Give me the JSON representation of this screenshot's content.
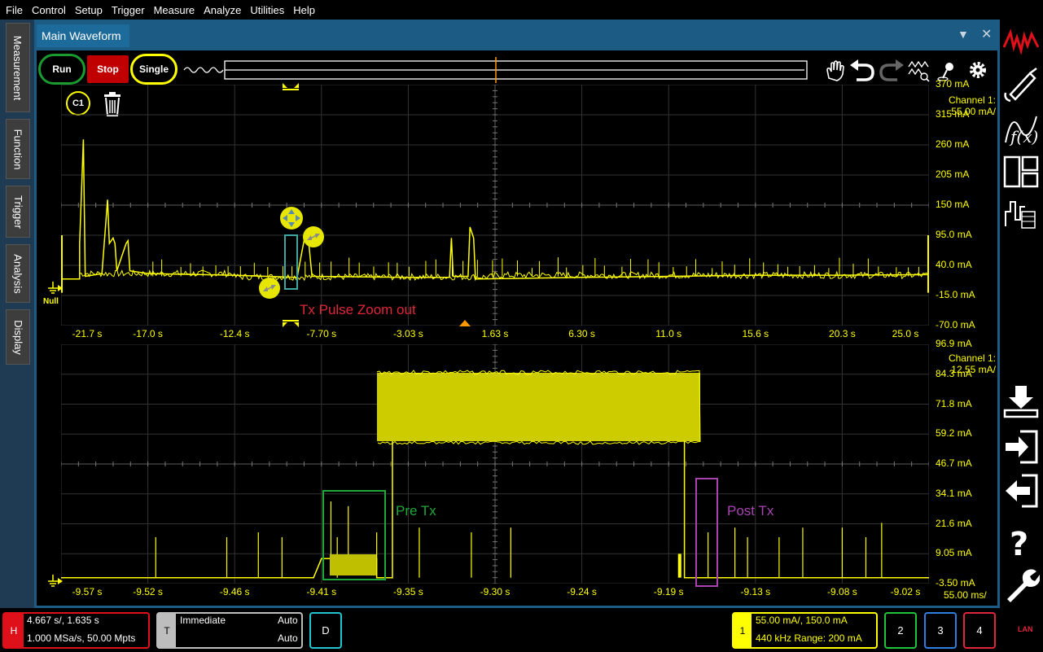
{
  "menu": [
    "File",
    "Control",
    "Setup",
    "Trigger",
    "Measure",
    "Analyze",
    "Utilities",
    "Help"
  ],
  "left_tabs": [
    "Measurement",
    "Function",
    "Trigger",
    "Analysis",
    "Display"
  ],
  "window": {
    "title": "Main Waveform"
  },
  "acquisition": {
    "run": "Run",
    "stop": "Stop",
    "single": "Single"
  },
  "channel_badge": "C1",
  "ground_marker": "Null",
  "colors": {
    "trace": "#ffff00",
    "grid": "#3a3a3a",
    "pre_tx": "#1fa83a",
    "post_tx": "#a843b0",
    "zoom_box": "#3fa7a0",
    "annot_red": "#e0263a"
  },
  "icons": [
    "hand-icon",
    "undo-icon",
    "redo-icon",
    "waveform-zoom-icon",
    "pin-icon",
    "gear-icon",
    "keysight-logo-icon",
    "probe-icon",
    "function-icon",
    "layout-icon",
    "digital-icon",
    "download-icon",
    "import-icon",
    "export-icon",
    "help-icon",
    "wrench-icon"
  ],
  "annotations": {
    "zoom_out": "Tx Pulse Zoom out",
    "pre_tx": "Pre Tx",
    "post_tx": "Post Tx"
  },
  "chart_data": [
    {
      "type": "line",
      "title": "",
      "scale_label": "Channel 1:  55.00 mA/",
      "y_ticks": [
        "370 mA",
        "315 mA",
        "260 mA",
        "205 mA",
        "150 mA",
        "95.0 mA",
        "40.0 mA",
        "-15.0 mA",
        "-70.0 mA"
      ],
      "x_ticks": [
        "-21.7 s",
        "-17.0 s",
        "-12.4 s",
        "-7.70 s",
        "-3.03 s",
        "1.63 s",
        "6.30 s",
        "11.0 s",
        "15.6 s",
        "20.3 s",
        "25.0 s"
      ],
      "xlim": [
        -21.7,
        25.0
      ],
      "ylim": [
        -70.0,
        370.0
      ],
      "series": [
        {
          "points": [
            [
              -21.7,
              15
            ],
            [
              -20.7,
              15
            ],
            [
              -20.7,
              80
            ],
            [
              -20.5,
              270
            ],
            [
              -20.4,
              20
            ],
            [
              -19.5,
              25
            ],
            [
              -19.2,
              160
            ],
            [
              -19.1,
              80
            ],
            [
              -18.9,
              90
            ],
            [
              -18.8,
              80
            ],
            [
              -18.7,
              30
            ],
            [
              -18.2,
              80
            ],
            [
              -18.1,
              85
            ],
            [
              -18.0,
              30
            ],
            [
              -17.0,
              25
            ],
            [
              -12.4,
              22
            ],
            [
              -9.0,
              18
            ],
            [
              -8.6,
              90
            ],
            [
              -8.4,
              90
            ],
            [
              -8.2,
              20
            ],
            [
              -3.03,
              18
            ],
            [
              -0.8,
              18
            ],
            [
              -0.7,
              90
            ],
            [
              -0.6,
              20
            ],
            [
              0.2,
              20
            ],
            [
              0.3,
              110
            ],
            [
              0.5,
              90
            ],
            [
              0.6,
              15
            ],
            [
              6.3,
              18
            ],
            [
              11.0,
              20
            ],
            [
              15.6,
              22
            ],
            [
              20.3,
              22
            ],
            [
              25.0,
              23
            ]
          ]
        }
      ]
    },
    {
      "type": "line",
      "title": "",
      "scale_label": "Channel 1:  12.55 mA/",
      "y_ticks": [
        "96.9 mA",
        "84.3 mA",
        "71.8 mA",
        "59.2 mA",
        "46.7 mA",
        "34.1 mA",
        "21.6 mA",
        "9.05 mA",
        "-3.50 mA"
      ],
      "x_ticks": [
        "-9.57 s",
        "-9.52 s",
        "-9.46 s",
        "-9.41 s",
        "-9.35 s",
        "-9.30 s",
        "-9.24 s",
        "-9.19 s",
        "-9.13 s",
        "-9.08 s",
        "-9.02 s"
      ],
      "scale_x": "55.00 ms/",
      "xlim": [
        -9.57,
        -9.02
      ],
      "ylim": [
        -3.5,
        96.9
      ],
      "series": [
        {
          "points": [
            [
              -9.57,
              -1
            ],
            [
              -9.41,
              -1
            ],
            [
              -9.405,
              7
            ],
            [
              -9.37,
              7
            ],
            [
              -9.37,
              -1
            ],
            [
              -9.36,
              -1
            ],
            [
              -9.36,
              80
            ],
            [
              -9.175,
              80
            ],
            [
              -9.175,
              -1
            ],
            [
              -9.02,
              -1
            ]
          ]
        }
      ]
    }
  ],
  "bottom": {
    "horizontal": {
      "badge": "H",
      "line1": "4.667 s/, 1.635 s",
      "line2": "1.000 MSa/s, 50.00 Mpts"
    },
    "trigger": {
      "badge": "T",
      "mode": "Immediate",
      "auto1": "Auto",
      "auto2": "Auto"
    },
    "digital": "D",
    "ch1": {
      "badge": "1",
      "line1": "55.00 mA/, 150.0 mA",
      "line2": "440 kHz  Range: 200 mA"
    },
    "ch2": "2",
    "ch3": "3",
    "ch4": "4",
    "lan": "LAN"
  }
}
